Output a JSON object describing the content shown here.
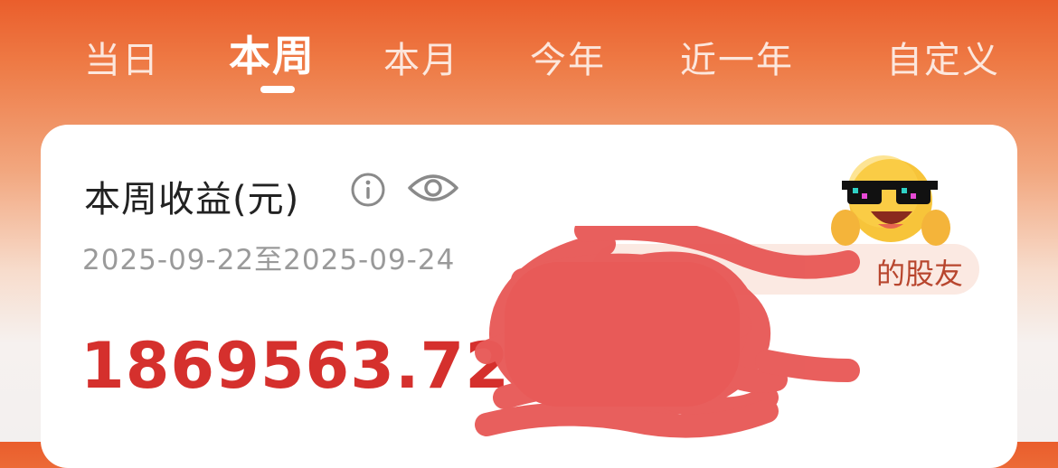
{
  "tabs": [
    {
      "label": "当日"
    },
    {
      "label": "本周",
      "active": true
    },
    {
      "label": "本月"
    },
    {
      "label": "今年"
    },
    {
      "label": "近一年"
    },
    {
      "label": "自定义"
    }
  ],
  "card": {
    "title": "本周收益(元)",
    "date_range": "2025-09-22至2025-09-24",
    "amount": "1869563.72",
    "rank_badge": "的股友"
  },
  "colors": {
    "accent": "#ea5e2c",
    "amount": "#d5302d",
    "redaction": "#e85a58"
  },
  "icons": [
    "info-icon",
    "eye-icon",
    "cool-emoji-icon"
  ]
}
